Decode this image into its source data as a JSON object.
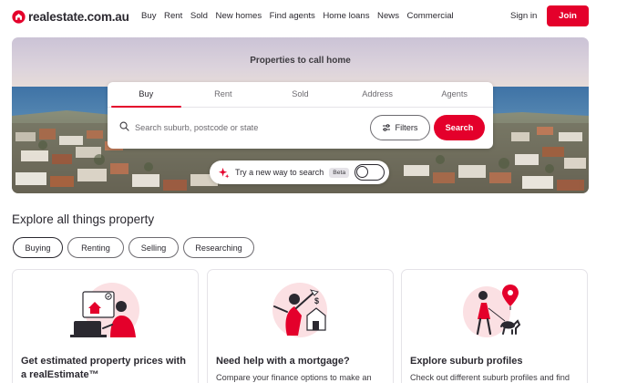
{
  "brand": {
    "name": "realestate.com.au",
    "accent_color": "#e4002b"
  },
  "nav": {
    "items": [
      "Buy",
      "Rent",
      "Sold",
      "New homes",
      "Find agents",
      "Home loans",
      "News",
      "Commercial"
    ],
    "sign_in": "Sign in",
    "join": "Join"
  },
  "hero": {
    "title": "Properties to call home",
    "tabs": [
      "Buy",
      "Rent",
      "Sold",
      "Address",
      "Agents"
    ],
    "active_tab": "Buy",
    "search": {
      "placeholder": "Search suburb, postcode or state",
      "value": ""
    },
    "filters_label": "Filters",
    "search_label": "Search",
    "ai_prompt": "Try a new way to search",
    "ai_badge": "Beta",
    "ai_toggle_on": false
  },
  "explore": {
    "title": "Explore all things property",
    "chips": [
      "Buying",
      "Renting",
      "Selling",
      "Researching"
    ],
    "active_chip": "Buying",
    "cards": [
      {
        "icon": "estimate-illustration",
        "title": "Get estimated property prices with a realEstimate™",
        "description": ""
      },
      {
        "icon": "mortgage-illustration",
        "title": "Need help with a mortgage?",
        "description": "Compare your finance options to make an"
      },
      {
        "icon": "suburb-illustration",
        "title": "Explore suburb profiles",
        "description": "Check out different suburb profiles and find"
      }
    ]
  }
}
